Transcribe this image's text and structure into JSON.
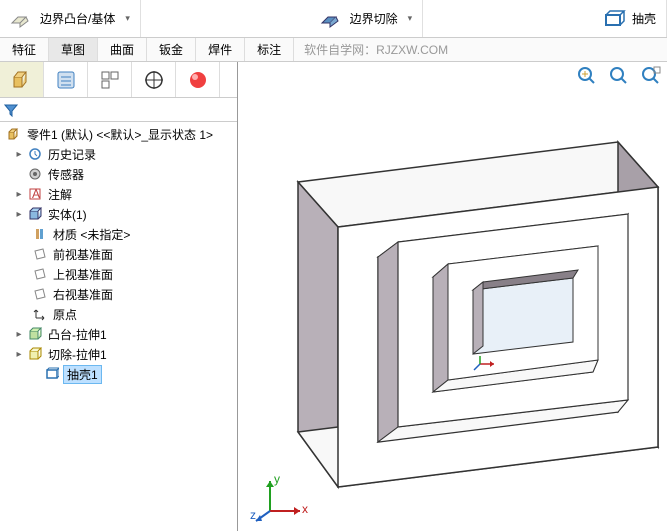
{
  "toolbar": {
    "boundary_boss": "边界凸台/基体",
    "boundary_cut": "边界切除",
    "shell": "抽壳"
  },
  "tabs": {
    "feature": "特征",
    "sketch": "草图",
    "surface": "曲面",
    "sheetmetal": "钣金",
    "weldment": "焊件",
    "annotation": "标注"
  },
  "watermark": "软件自学网：RJZXW.COM",
  "tree": {
    "root": "零件1 (默认) <<默认>_显示状态 1>",
    "history": "历史记录",
    "sensors": "传感器",
    "annotations": "注解",
    "solid": "实体(1)",
    "material": "材质 <未指定>",
    "front": "前视基准面",
    "top": "上视基准面",
    "right": "右视基准面",
    "origin": "原点",
    "boss1": "凸台-拉伸1",
    "cut1": "切除-拉伸1",
    "shell1": "抽壳1"
  },
  "axes": {
    "x": "x",
    "y": "y",
    "z": "z"
  }
}
